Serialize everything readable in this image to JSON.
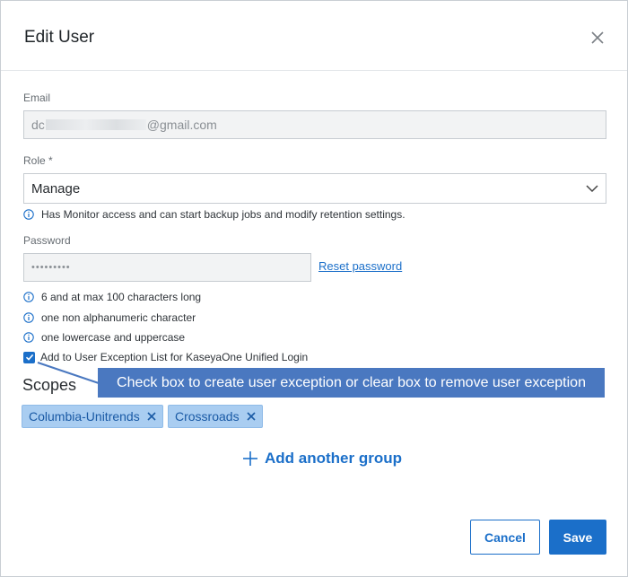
{
  "dialog": {
    "title": "Edit User"
  },
  "email": {
    "label": "Email",
    "value_prefix": "dc",
    "value_suffix": "@gmail.com"
  },
  "role": {
    "label": "Role *",
    "value": "Manage",
    "hint": "Has Monitor access and can start backup jobs and modify retention settings."
  },
  "password": {
    "label": "Password",
    "value": "•••••••••",
    "reset_label": "Reset password",
    "rules": [
      "6 and at max 100 characters long",
      "one non alphanumeric character",
      "one lowercase and uppercase"
    ]
  },
  "exception": {
    "label": "Add to User Exception List for KaseyaOne Unified Login",
    "checked": true
  },
  "callout": {
    "text": "Check box to create user exception or clear box to remove user exception"
  },
  "scopes": {
    "title": "Scopes",
    "groups": [
      "Columbia-Unitrends",
      "Crossroads"
    ],
    "add_label": "Add another group"
  },
  "footer": {
    "cancel_label": "Cancel",
    "save_label": "Save"
  },
  "icons": {
    "close": "close-icon",
    "chevron": "chevron-down-icon",
    "info": "info-icon",
    "check": "check-icon",
    "remove": "remove-chip-icon",
    "plus": "plus-icon"
  },
  "colors": {
    "accent": "#1b6fc9",
    "chip_bg": "#a9cdf1",
    "callout_bg": "#4a78c0"
  }
}
